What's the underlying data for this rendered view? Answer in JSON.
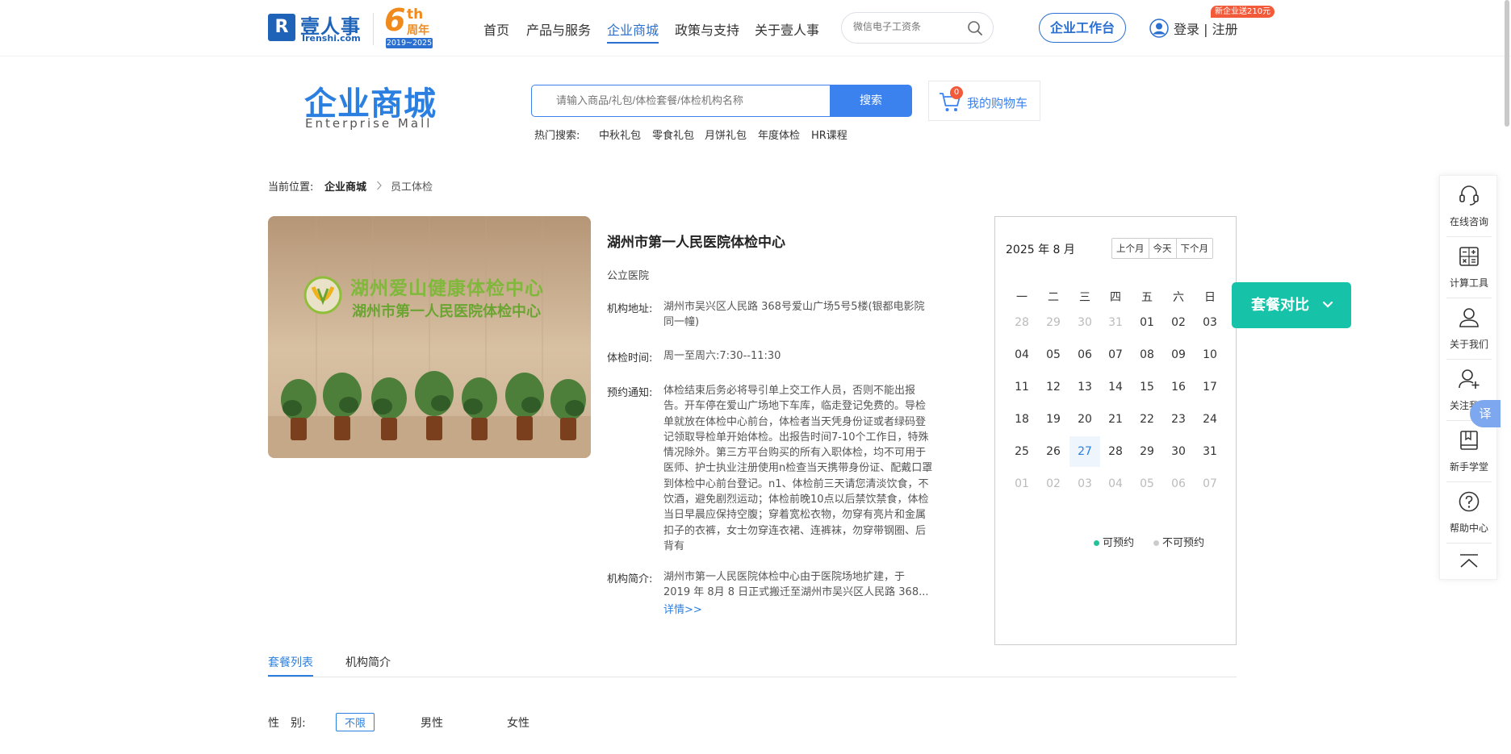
{
  "header": {
    "logo_mark": "R",
    "logo_cn": "壹人事",
    "logo_en": "Irenshi.com",
    "anniversary_num": "6",
    "anniversary_th": "th",
    "anniversary_label": "周年",
    "anniversary_years": "2019~2025",
    "nav": [
      "首页",
      "产品与服务",
      "企业商城",
      "政策与支持",
      "关于壹人事"
    ],
    "active_nav": "企业商城",
    "search_placeholder": "微信电子工资条",
    "workbench_label": "企业工作台",
    "login_label": "登录 | 注册",
    "promo_badge": "新企业送210元"
  },
  "mall": {
    "title_cn": "企业商城",
    "title_en": "Enterprise Mall",
    "search_placeholder": "请输入商品/礼包/体检套餐/体检机构名称",
    "search_button": "搜索",
    "cart_count": "0",
    "cart_label": "我的购物车",
    "hot_label": "热门搜索:",
    "hot_items": [
      "中秋礼包",
      "零食礼包",
      "月饼礼包",
      "年度体检",
      "HR课程"
    ]
  },
  "breadcrumb": {
    "prefix": "当前位置:",
    "items": [
      "企业商城",
      "员工体检"
    ]
  },
  "org": {
    "image_sign_line1": "湖州爱山健康体检中心",
    "image_sign_line2": "湖州市第一人民医院体检中心",
    "title": "湖州市第一人民医院体检中心",
    "type": "公立医院",
    "address_label": "机构地址:",
    "address": "湖州市吴兴区人民路 368号爱山广场5号5楼(银都电影院同一幢)",
    "hours_label": "体检时间:",
    "hours": "周一至周六:7:30--11:30",
    "notice_label": "预约通知:",
    "notice": "体检结束后务必将导引单上交工作人员，否则不能出报告。开车停在爱山广场地下车库，临走登记免费的。导检单就放在体检中心前台，体检者当天凭身份证或者绿码登记领取导检单开始体检。出报告时间7-10个工作日，特殊情况除外。第三方平台购买的所有入职体检，均不可用于医师、护士执业注册使用n检查当天携带身份证、配戴口罩到体检中心前台登记。n1、体检前三天请您清淡饮食，不饮酒，避免剧烈运动；体检前晚10点以后禁饮禁食，体检当日早晨应保持空腹；穿着宽松衣物，勿穿有亮片和金属扣子的衣裤，女士勿穿连衣裙、连裤袜，勿穿带钢圈、后背有",
    "intro_label": "机构简介:",
    "intro": "湖州市第一人民医院体检中心由于医院场地扩建，于 2019 年 8月 8 日正式搬迁至湖州市吴兴区人民路 368...",
    "more_link": "详情>>"
  },
  "calendar": {
    "title": "2025 年 8 月",
    "buttons": [
      "上个月",
      "今天",
      "下个月"
    ],
    "weekdays": [
      "一",
      "二",
      "三",
      "四",
      "五",
      "六",
      "日"
    ],
    "weeks": [
      [
        "28",
        "29",
        "30",
        "31",
        "01",
        "02",
        "03"
      ],
      [
        "04",
        "05",
        "06",
        "07",
        "08",
        "09",
        "10"
      ],
      [
        "11",
        "12",
        "13",
        "14",
        "15",
        "16",
        "17"
      ],
      [
        "18",
        "19",
        "20",
        "21",
        "22",
        "23",
        "24"
      ],
      [
        "25",
        "26",
        "27",
        "28",
        "29",
        "30",
        "31"
      ],
      [
        "01",
        "02",
        "03",
        "04",
        "05",
        "06",
        "07"
      ]
    ],
    "today": "27",
    "legend_available": "可预约",
    "legend_unavailable": "不可预约",
    "available_color": "#22c39a",
    "unavailable_color": "#cccccc"
  },
  "compare_button": "套餐对比",
  "tabs": [
    "套餐列表",
    "机构简介"
  ],
  "filter": {
    "label": "性　别:",
    "options": [
      "不限",
      "男性",
      "女性"
    ],
    "selected": "不限"
  },
  "sidebar": [
    "在线咨询",
    "计算工具",
    "关于我们",
    "关注我们",
    "新手学堂",
    "帮助中心"
  ],
  "translate_label": "译",
  "colors": {
    "brand": "#2b7fe0",
    "teal": "#16c3a8",
    "badge_red": "#f25a3a",
    "anniversary_orange": "#f08a1c"
  }
}
